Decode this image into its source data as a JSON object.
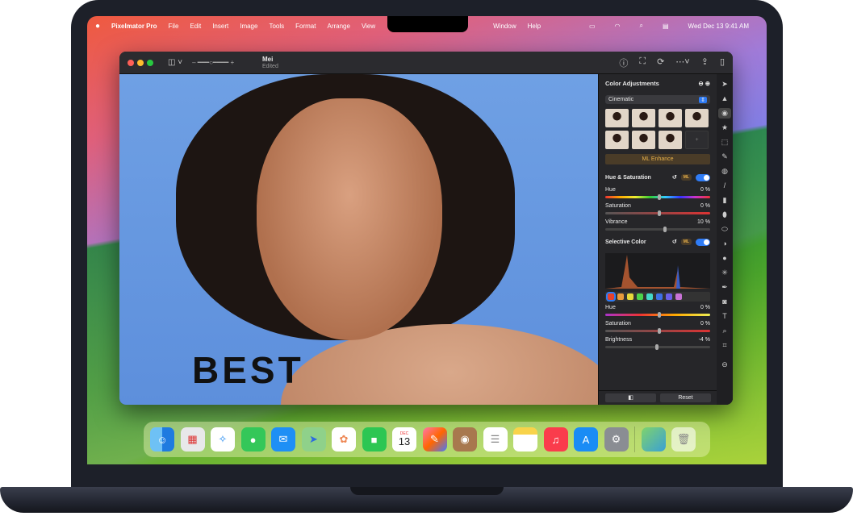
{
  "menubar": {
    "app": "Pixelmator Pro",
    "items": [
      "File",
      "Edit",
      "Insert",
      "Image",
      "Tools",
      "Format",
      "Arrange",
      "View",
      "Window",
      "Help"
    ],
    "clock": "Wed Dec 13  9:41 AM"
  },
  "window": {
    "title": "Mei",
    "subtitle": "Edited"
  },
  "canvas": {
    "doodle_text": "BEST"
  },
  "panel": {
    "title": "Color Adjustments",
    "preset": "Cinematic",
    "ml_enhance": "ML Enhance",
    "ml_badge": "ML",
    "hue_sat": {
      "title": "Hue & Saturation",
      "rows": [
        {
          "label": "Hue",
          "value": "0 %",
          "pos": 0.5
        },
        {
          "label": "Saturation",
          "value": "0 %",
          "pos": 0.5
        },
        {
          "label": "Vibrance",
          "value": "10 %",
          "pos": 0.55
        }
      ]
    },
    "selective": {
      "title": "Selective Color",
      "swatches": [
        "#e8412c",
        "#e99a3c",
        "#e6d83a",
        "#4bd34b",
        "#43d9c9",
        "#3e6fe6",
        "#6a5fe8",
        "#c873d6"
      ],
      "rows": [
        {
          "label": "Hue",
          "value": "0 %",
          "pos": 0.5
        },
        {
          "label": "Saturation",
          "value": "0 %",
          "pos": 0.5
        },
        {
          "label": "Brightness",
          "value": "-4 %",
          "pos": 0.48
        }
      ]
    },
    "reset": "Reset"
  },
  "dock": {
    "calendar_month": "DEC",
    "calendar_day": "13",
    "apps": [
      "finder",
      "launchpad",
      "safari",
      "messages",
      "mail",
      "maps",
      "photos",
      "facetime",
      "calendar",
      "pixelmator",
      "contacts",
      "reminders",
      "notes",
      "music",
      "app-store",
      "system-settings"
    ]
  },
  "colors": {
    "accent": "#2f7cf6",
    "ml": "#e6b04a"
  }
}
